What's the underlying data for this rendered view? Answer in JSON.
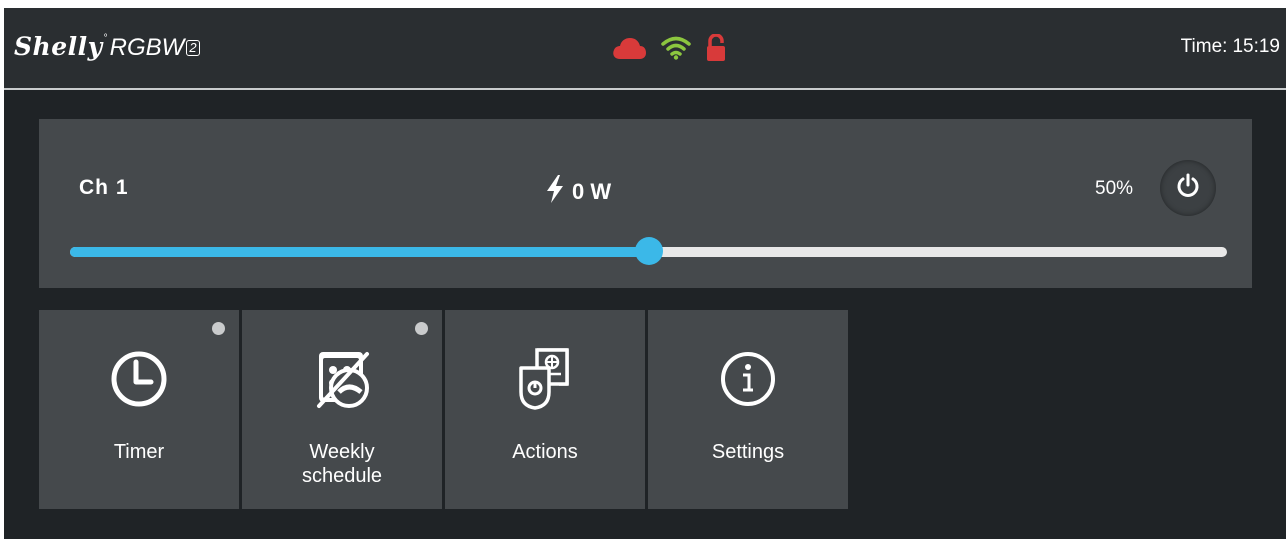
{
  "header": {
    "brand_name": "Shelly",
    "brand_dot": "°",
    "model": "RGBW",
    "version": "2",
    "time_label": "Time:",
    "time_value": "15:19",
    "status_icons": [
      "cloud-icon",
      "wifi-icon",
      "lock-open-icon"
    ]
  },
  "channel": {
    "name": "Ch 1",
    "power": "0 W",
    "brightness_label": "50%",
    "brightness": 50
  },
  "tiles": [
    {
      "label": "Timer",
      "icon": "clock-icon",
      "has_indicator": true
    },
    {
      "label": "Weekly\nschedule",
      "label_line1": "Weekly",
      "label_line2": "schedule",
      "icon": "schedule-disabled-icon",
      "has_indicator": true
    },
    {
      "label": "Actions",
      "icon": "actions-icon",
      "has_indicator": false
    },
    {
      "label": "Settings",
      "icon": "info-icon",
      "has_indicator": false
    }
  ],
  "colors": {
    "accent": "#3bb8e8",
    "cloud": "#d83a3a",
    "wifi": "#8cc63f",
    "lock": "#d83a3a",
    "panel": "#45494c",
    "background": "#1f2326"
  }
}
